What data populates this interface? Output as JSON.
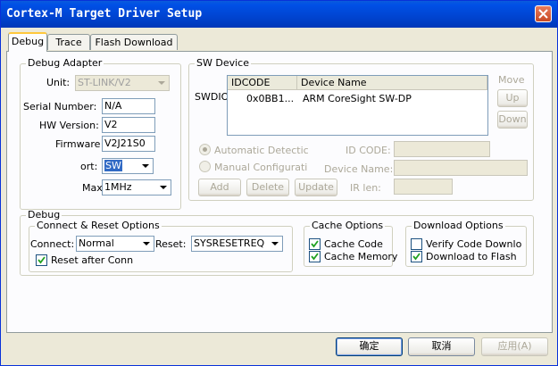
{
  "window": {
    "title": "Cortex-M Target Driver Setup"
  },
  "tabs": [
    {
      "label": "Debug",
      "active": true
    },
    {
      "label": "Trace",
      "active": false
    },
    {
      "label": "Flash Download",
      "active": false
    }
  ],
  "debug_adapter": {
    "group_label": "Debug Adapter",
    "unit_label": "Unit:",
    "unit_value": "ST-LINK/V2",
    "serial_label": "Serial Number:",
    "serial_value": "N/A",
    "hw_label": "HW Version:",
    "hw_value": "V2",
    "firmware_label": "Firmware",
    "firmware_value": "V2J21S0",
    "port_label": "ort:",
    "port_value": "SW",
    "max_label": "Max",
    "max_value": "1MHz"
  },
  "sw_device": {
    "group_label": "SW Device",
    "swdio_label": "SWDIO",
    "columns": [
      "IDCODE",
      "Device Name"
    ],
    "rows": [
      {
        "idcode": "0x0BB1...",
        "device_name": "ARM CoreSight SW-DP"
      }
    ],
    "move_label": "Move",
    "up_label": "Up",
    "down_label": "Down",
    "auto_detect_label": "Automatic Detectic",
    "manual_config_label": "Manual Configurati",
    "id_code_label": "ID CODE:",
    "device_name_label": "Device Name:",
    "ir_len_label": "IR len:",
    "add_label": "Add",
    "delete_label": "Delete",
    "update_label": "Update"
  },
  "debug": {
    "group_label": "Debug",
    "connect_reset": {
      "group_label": "Connect & Reset Options",
      "connect_label": "Connect:",
      "connect_value": "Normal",
      "reset_label": "Reset:",
      "reset_value": "SYSRESETREQ",
      "reset_after_conn_label": "Reset after Conn",
      "reset_after_conn_checked": true
    },
    "cache": {
      "group_label": "Cache Options",
      "cache_code_label": "Cache Code",
      "cache_code_checked": true,
      "cache_memory_label": "Cache Memory",
      "cache_memory_checked": true
    },
    "download": {
      "group_label": "Download Options",
      "verify_label": "Verify Code Downlo",
      "verify_checked": false,
      "download_flash_label": "Download to Flash",
      "download_flash_checked": true
    }
  },
  "footer": {
    "ok_label": "确定",
    "cancel_label": "取消",
    "apply_label": "应用(A)"
  }
}
